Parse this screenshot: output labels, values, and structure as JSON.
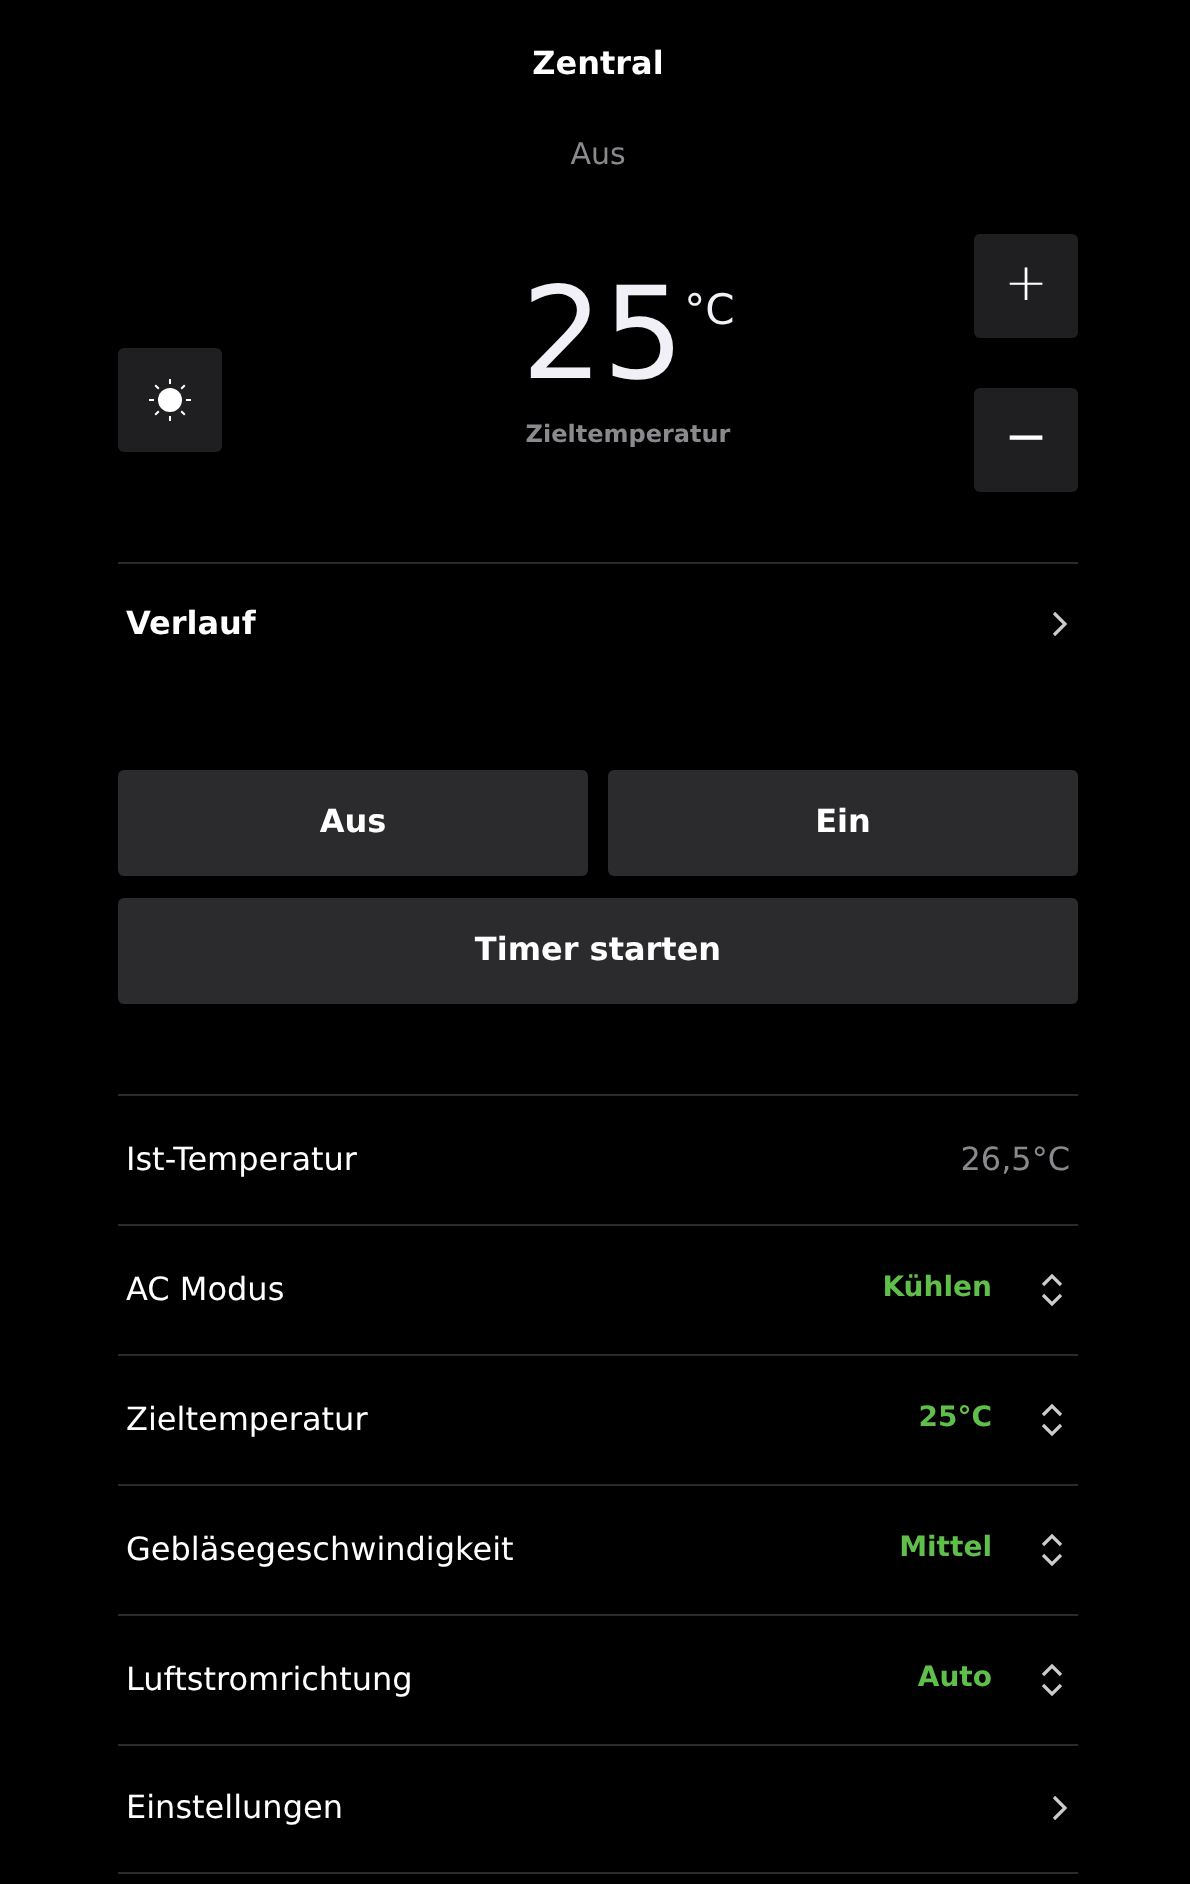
{
  "header": {
    "title": "Zentral",
    "status": "Aus"
  },
  "thermostat": {
    "temperature": "25",
    "unit": "°C",
    "caption": "Zieltemperatur",
    "increase": "+",
    "decrease": "−"
  },
  "history": {
    "label": "Verlauf"
  },
  "buttons": [
    "Aus",
    "Ein"
  ],
  "timer_button": "Timer starten",
  "settings": [
    {
      "kind": "reading",
      "label": "Ist-Temperatur",
      "value": "26,5°C"
    },
    {
      "kind": "select",
      "label": "AC Modus",
      "value": "Kühlen"
    },
    {
      "kind": "select",
      "label": "Zieltemperatur",
      "value": "25°C"
    },
    {
      "kind": "select",
      "label": "Gebläsegeschwindigkeit",
      "value": "Mittel"
    },
    {
      "kind": "select",
      "label": "Luftstromrichtung",
      "value": "Auto"
    },
    {
      "kind": "link",
      "label": "Einstellungen"
    }
  ]
}
